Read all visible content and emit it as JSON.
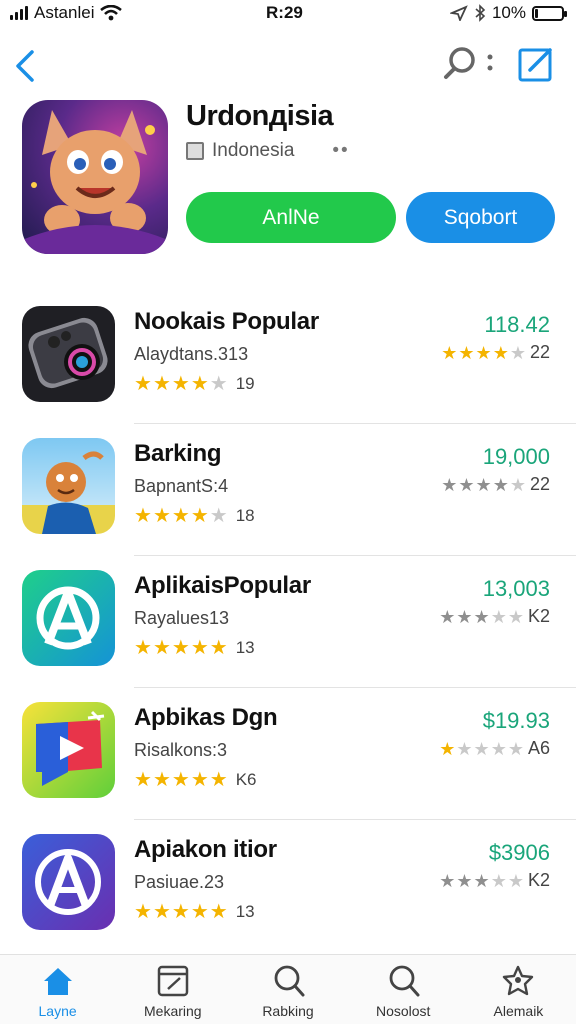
{
  "status_bar": {
    "carrier": "Astanlei",
    "time": "R:29",
    "battery": "10%",
    "battery_level": 0.1
  },
  "hero": {
    "title": "Urdonдisia",
    "subtitle": "Indonesia",
    "dots": "••",
    "primary_button": "AnlNe",
    "secondary_button": "Sqobort"
  },
  "apps": [
    {
      "name": "Nookais Popular",
      "sub": "Alaydtans.313",
      "rating_count": "19",
      "price": "118.42",
      "meta_value": "22",
      "stars": 4,
      "meta_stars": 4,
      "meta_star_style": "gold"
    },
    {
      "name": "Barking",
      "sub": "BapnantS:4",
      "rating_count": "18",
      "price": "19,000",
      "meta_value": "22",
      "stars": 4,
      "meta_stars": 4,
      "meta_star_style": "grey"
    },
    {
      "name": "AplikaisPopular",
      "sub": "Rayalues13",
      "rating_count": "13",
      "price": "13,003",
      "meta_value": "K2",
      "stars": 5,
      "meta_stars": 3,
      "meta_star_style": "grey"
    },
    {
      "name": "Apbikas Dgn",
      "sub": "Risalkons:3",
      "rating_count": "K6",
      "price": "$19.93",
      "meta_value": "A6",
      "stars": 5,
      "meta_stars": 1,
      "meta_star_style": "gold"
    },
    {
      "name": "Apiakon itior",
      "sub": "Pasiuae.23",
      "rating_count": "13",
      "price": "$3906",
      "meta_value": "K2",
      "stars": 5,
      "meta_stars": 3,
      "meta_star_style": "grey"
    }
  ],
  "tabs": [
    {
      "label": "Layne",
      "icon": "home-icon",
      "active": true
    },
    {
      "label": "Mekaring",
      "icon": "edit-doc-icon",
      "active": false
    },
    {
      "label": "Rabking",
      "icon": "search-icon",
      "active": false
    },
    {
      "label": "Nosolost",
      "icon": "search-icon",
      "active": false
    },
    {
      "label": "Alemaik",
      "icon": "star-person-icon",
      "active": false
    }
  ],
  "colors": {
    "accent_blue": "#1a8fe6",
    "accent_green": "#22c94b",
    "price_green": "#1aa57a",
    "star_gold": "#f4b400"
  }
}
